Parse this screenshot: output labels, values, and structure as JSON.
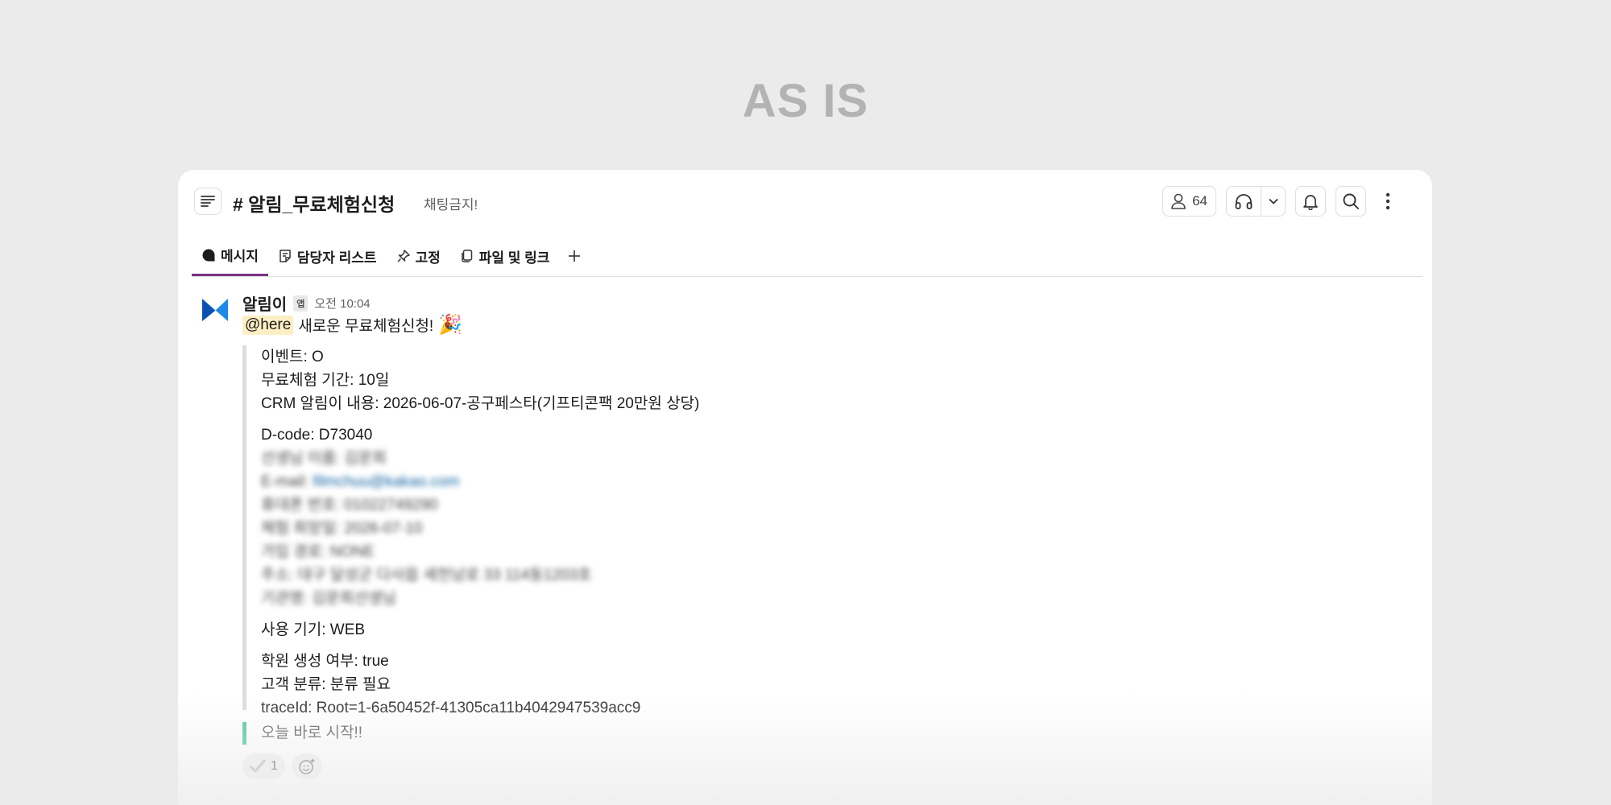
{
  "page_heading": "AS IS",
  "header": {
    "channel_name": "# 알림_무료체험신청",
    "topic": "채팅금지!",
    "member_count": "64"
  },
  "tabs": [
    {
      "label": "메시지",
      "icon": "message-icon",
      "active": true
    },
    {
      "label": "담당자 리스트",
      "icon": "canvas-icon"
    },
    {
      "label": "고정",
      "icon": "pin-icon"
    },
    {
      "label": "파일 및 링크",
      "icon": "files-icon"
    }
  ],
  "message": {
    "sender": "알림이",
    "badge": "앱",
    "time": "오전 10:04",
    "mention": "@here",
    "text": "새로운 무료체험신청!",
    "emoji": "🎉",
    "attachment": {
      "event": "이벤트: O",
      "trial_period": "무료체험 기간: 10일",
      "crm_content": "CRM 알림이 내용: 2026-06-07-공구페스타(기프티콘팩 20만원 상당)",
      "dcode": "D-code: D73040",
      "blurred_1": "선생님 이름: 김문희",
      "blurred_email_label": "E-mail:",
      "blurred_email": "filmchuu@kakao.com",
      "blurred_3": "휴대폰 번호: 01022749290",
      "blurred_4": "체험 희망일: 2026-07-10",
      "blurred_5": "가입 경로: NONE",
      "blurred_6": "주소: 대구 달성군 다사읍 세천남로 33 114동1203호",
      "blurred_7": "기관명: 김문희선생님",
      "device": "사용 기기: WEB",
      "academy_created": "학원 생성 여부: true",
      "customer_category": "고객 분류: 분류 필요",
      "trace_id": "traceId: Root=1-6a50452f-41305ca11b4042947539acc9"
    },
    "attachment2_text": "오늘 바로 시작!!",
    "reaction_count": "1"
  },
  "colors": {
    "tab_active": "#7c3085",
    "mention_bg": "#fcefc3",
    "attachment2_bar": "#4fc6a0",
    "link": "#1264a3"
  }
}
